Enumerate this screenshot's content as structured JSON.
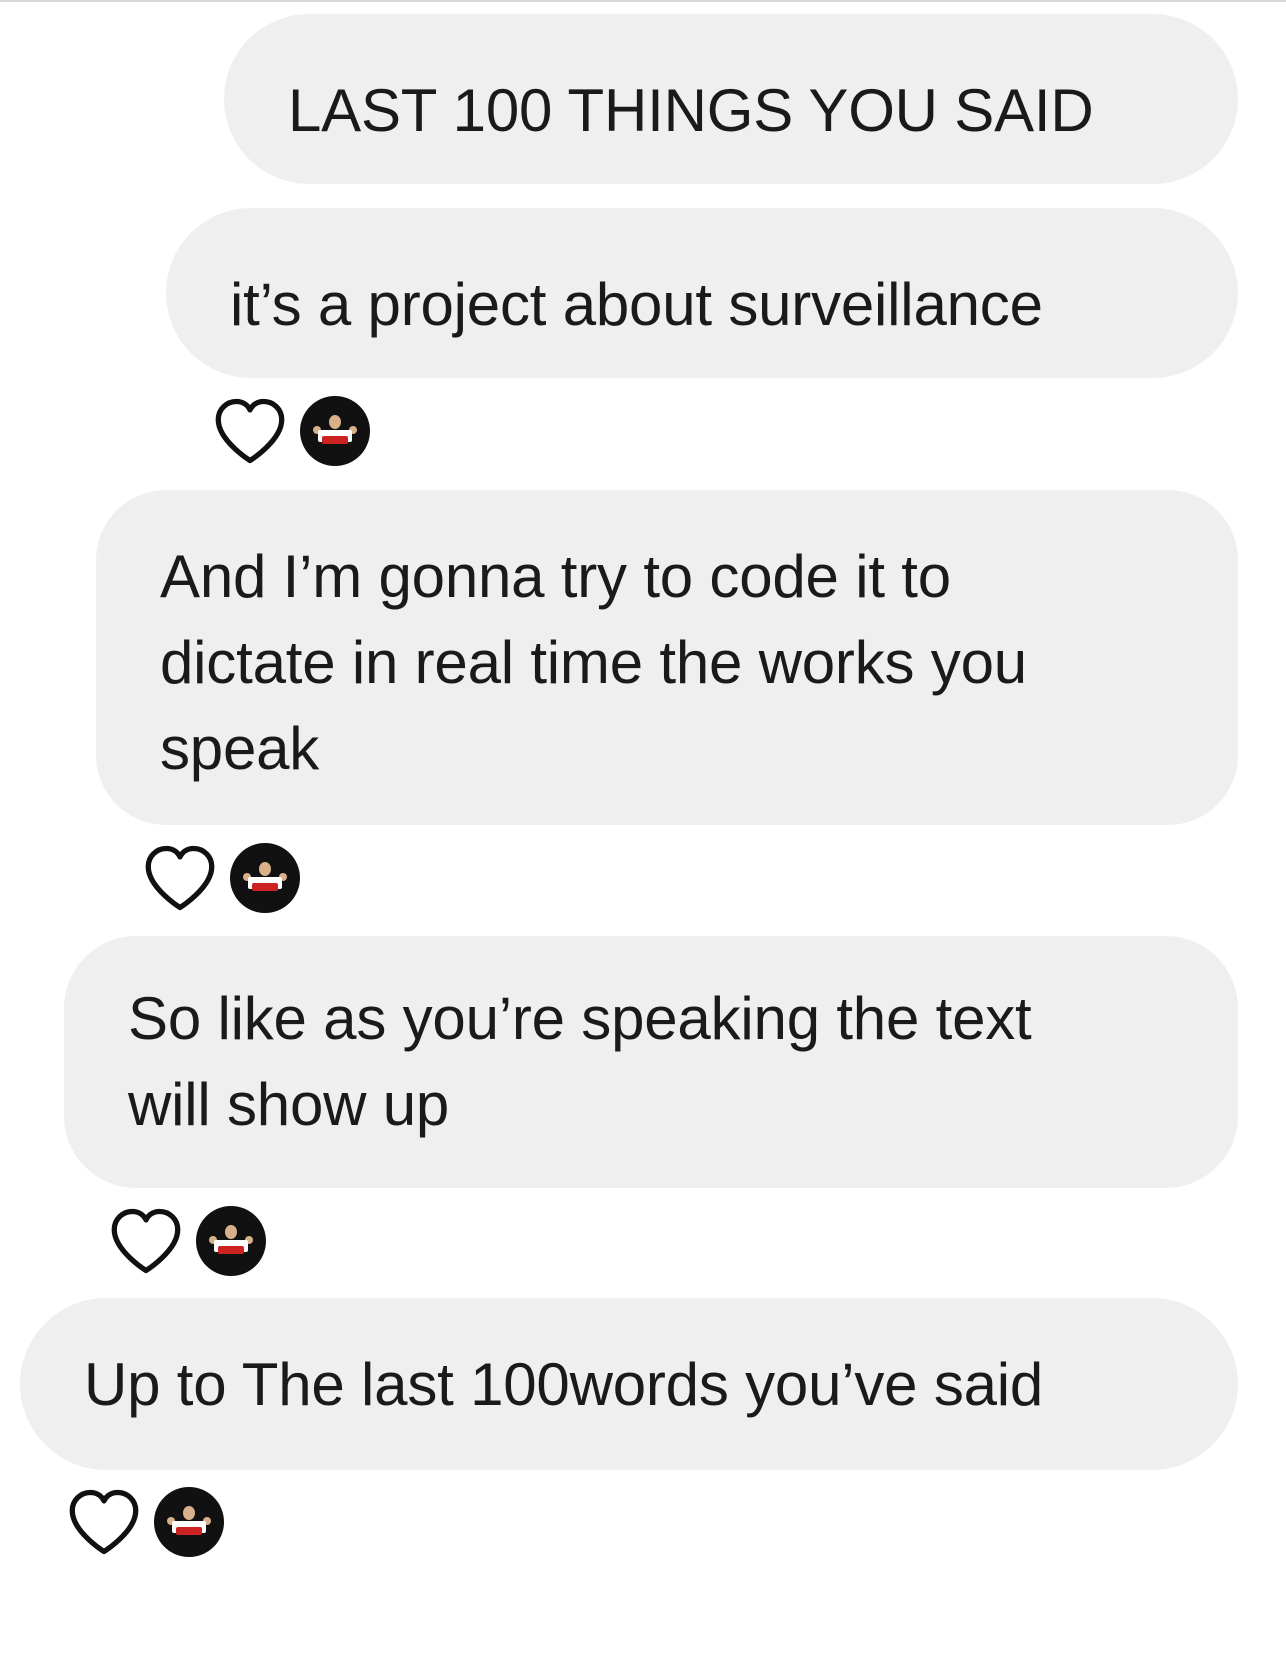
{
  "messages": [
    {
      "text": "LAST 100 THINGS YOU SAID",
      "reacted": false
    },
    {
      "text": "it’s a project about surveillance",
      "reacted": true
    },
    {
      "text": "And I’m gonna try to code it to\ndictate in real time the works you\nspeak",
      "reacted": true
    },
    {
      "text": "So like as you’re speaking the text\nwill show up",
      "reacted": true
    },
    {
      "text": "Up to The last 100words you’ve said",
      "reacted": true
    }
  ],
  "icons": {
    "reaction": "heart-outline-icon",
    "reactor": "avatar"
  },
  "colors": {
    "bubble": "#efefef",
    "text": "#1a1a1a",
    "background": "#ffffff"
  }
}
